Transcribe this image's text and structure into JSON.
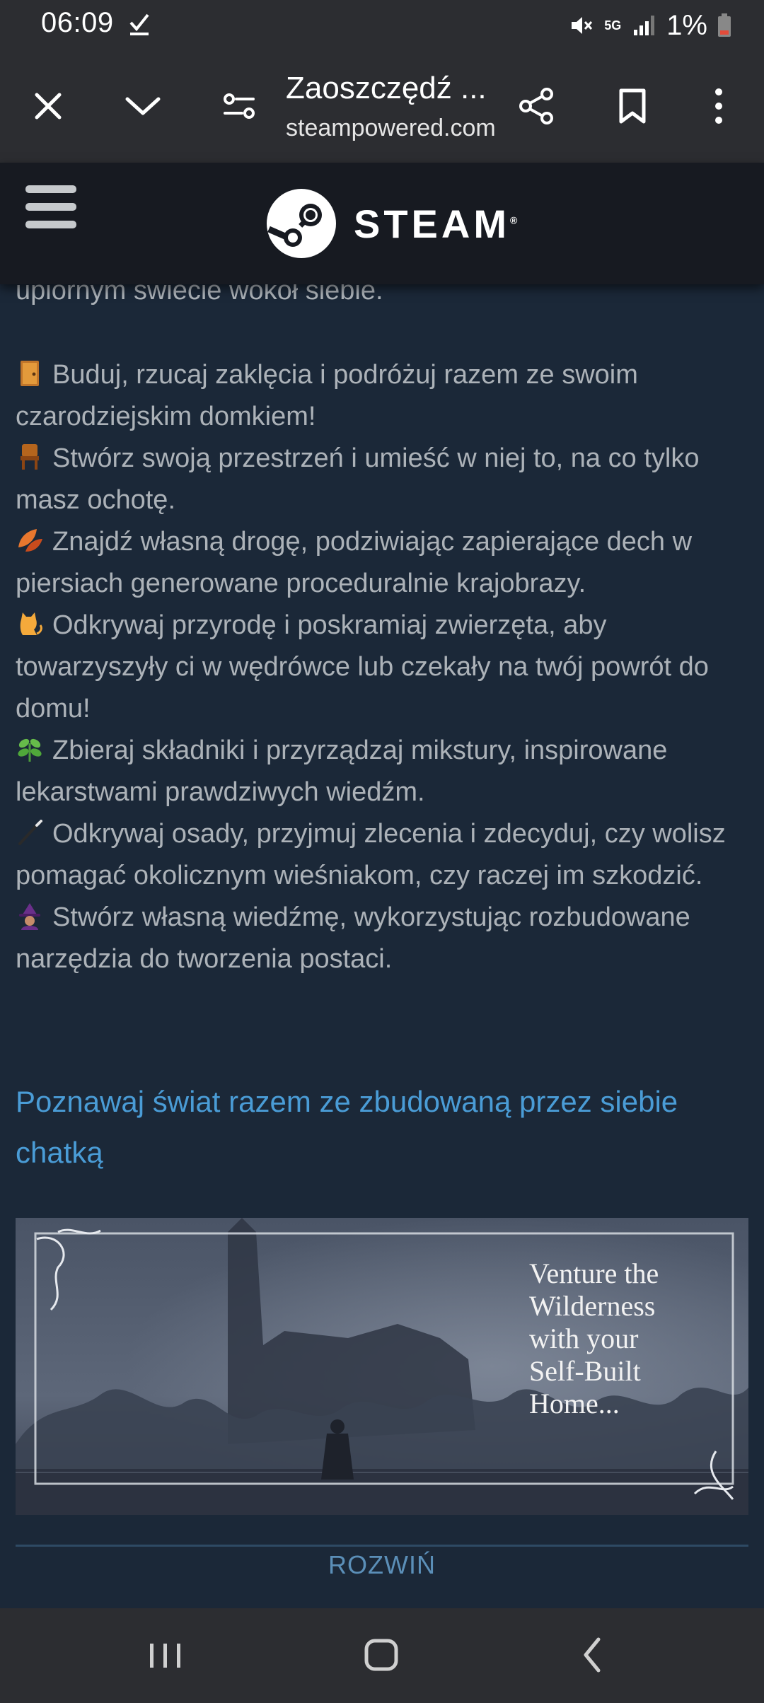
{
  "status_bar": {
    "time": "06:09",
    "network": "5G",
    "battery": "1%"
  },
  "browser": {
    "title": "Zaoszczędź ...",
    "url": "steampowered.com"
  },
  "steam": {
    "wordmark": "STEAM",
    "reg": "®"
  },
  "description": {
    "intro_tail": "upiornym świecie wokół siebie.",
    "features": [
      {
        "icon": "door-emoji",
        "text": "Buduj, rzucaj zaklęcia i podróżuj razem ze swoim czarodziejskim domkiem!"
      },
      {
        "icon": "chair-emoji",
        "text": "Stwórz swoją przestrzeń i umieść w niej to, na co tylko masz ochotę."
      },
      {
        "icon": "leaves-emoji",
        "text": "Znajdź własną drogę, podziwiając zapierające dech w piersiach generowane proceduralnie krajobrazy."
      },
      {
        "icon": "cat-emoji",
        "text": "Odkrywaj przyrodę i poskramiaj zwierzęta, aby towarzyszyły ci w wędrówce lub czekały na twój powrót do domu!"
      },
      {
        "icon": "herb-emoji",
        "text": "Zbieraj składniki i przyrządzaj mikstury, inspirowane lekarstwami prawdziwych wiedźm."
      },
      {
        "icon": "wand-emoji",
        "text": "Odkrywaj osady, przyjmuj zlecenia i zdecyduj, czy wolisz pomagać okolicznym wieśniakom, czy raczej im szkodzić."
      },
      {
        "icon": "witch-emoji",
        "text": "Stwórz własną wiedźmę, wykorzystując rozbudowane narzędzia do tworzenia postaci."
      }
    ]
  },
  "section": {
    "heading": "Poznawaj świat razem ze zbudowaną przez siebie chatką"
  },
  "banner": {
    "lines": [
      "Venture the",
      "Wilderness",
      "with your",
      "Self-Built",
      "Home..."
    ]
  },
  "expand": {
    "label": "ROZWIŃ"
  },
  "colors": {
    "page_bg": "#1b2838",
    "header_bg": "#171a21",
    "body_text": "#acb2b8",
    "link": "#4a9cd6",
    "chrome_bg": "#2c2d31"
  }
}
